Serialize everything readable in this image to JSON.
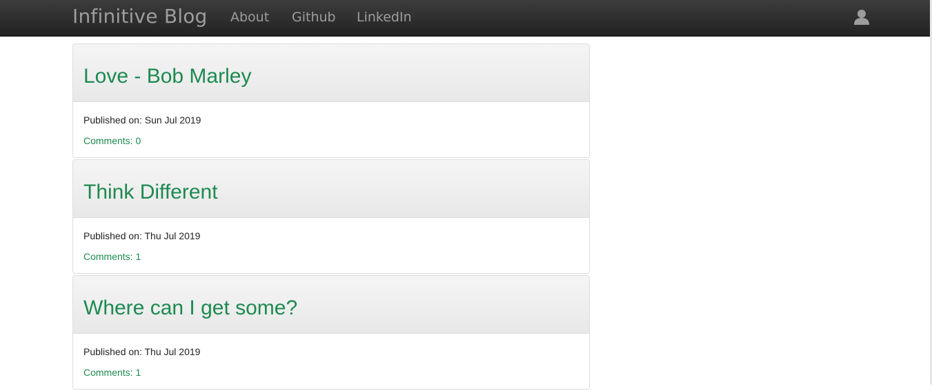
{
  "navbar": {
    "brand": "Infinitive Blog",
    "links": [
      {
        "label": "About"
      },
      {
        "label": "Github"
      },
      {
        "label": "LinkedIn"
      }
    ],
    "user_icon": "user-icon"
  },
  "posts": [
    {
      "title": "Love - Bob Marley",
      "published_prefix": "Published on:",
      "published": "Sun Jul 2019",
      "comments_label": "Comments: 0"
    },
    {
      "title": "Think Different",
      "published_prefix": "Published on:",
      "published": "Thu Jul 2019",
      "comments_label": "Comments: 1"
    },
    {
      "title": "Where can I get some?",
      "published_prefix": "Published on:",
      "published": "Thu Jul 2019",
      "comments_label": "Comments: 1"
    }
  ],
  "colors": {
    "accent": "#1d8a50",
    "navbar": "#222222",
    "nav_text": "#9d9d9d"
  }
}
